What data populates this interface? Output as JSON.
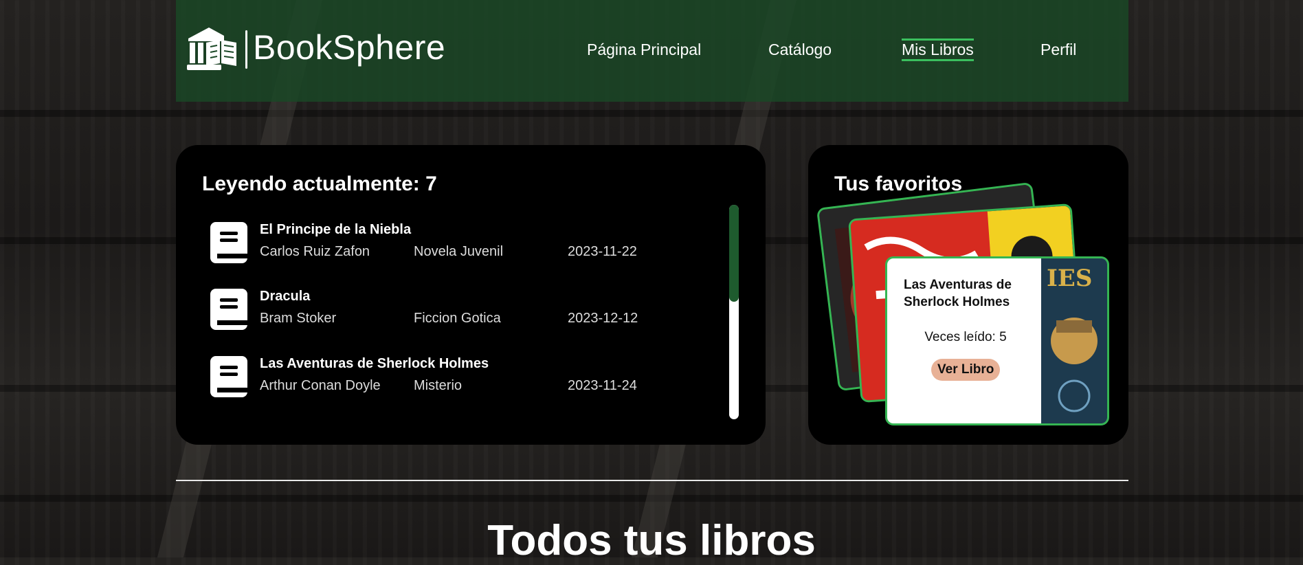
{
  "brand": {
    "name": "BookSphere",
    "icon": "library-book-icon"
  },
  "nav": {
    "items": [
      {
        "label": "Página Principal",
        "active": false
      },
      {
        "label": "Catálogo",
        "active": false
      },
      {
        "label": "Mis Libros",
        "active": true
      },
      {
        "label": "Perfil",
        "active": false
      }
    ]
  },
  "reading": {
    "title": "Leyendo actualmente: 7",
    "books": [
      {
        "title": "El Principe de la Niebla",
        "author": "Carlos Ruiz Zafon",
        "genre": "Novela Juvenil",
        "date": "2023-11-22"
      },
      {
        "title": "Dracula",
        "author": "Bram Stoker",
        "genre": "Ficcion Gotica",
        "date": "2023-12-12"
      },
      {
        "title": "Las Aventuras de Sherlock Holmes",
        "author": "Arthur Conan Doyle",
        "genre": "Misterio",
        "date": "2023-11-24"
      }
    ]
  },
  "favorites": {
    "title": "Tus favoritos",
    "book_title": "Las Aventuras de Sherlock Holmes",
    "times_read": "Veces leído: 5",
    "button_label": "Ver Libro"
  },
  "all_books": {
    "title": "Todos tus libros"
  },
  "colors": {
    "nav_bg": "#1a4826",
    "accent": "#3bbf5e",
    "card_border": "#35b553",
    "button": "#e8b196",
    "scroll_thumb": "#1e5b2e"
  }
}
